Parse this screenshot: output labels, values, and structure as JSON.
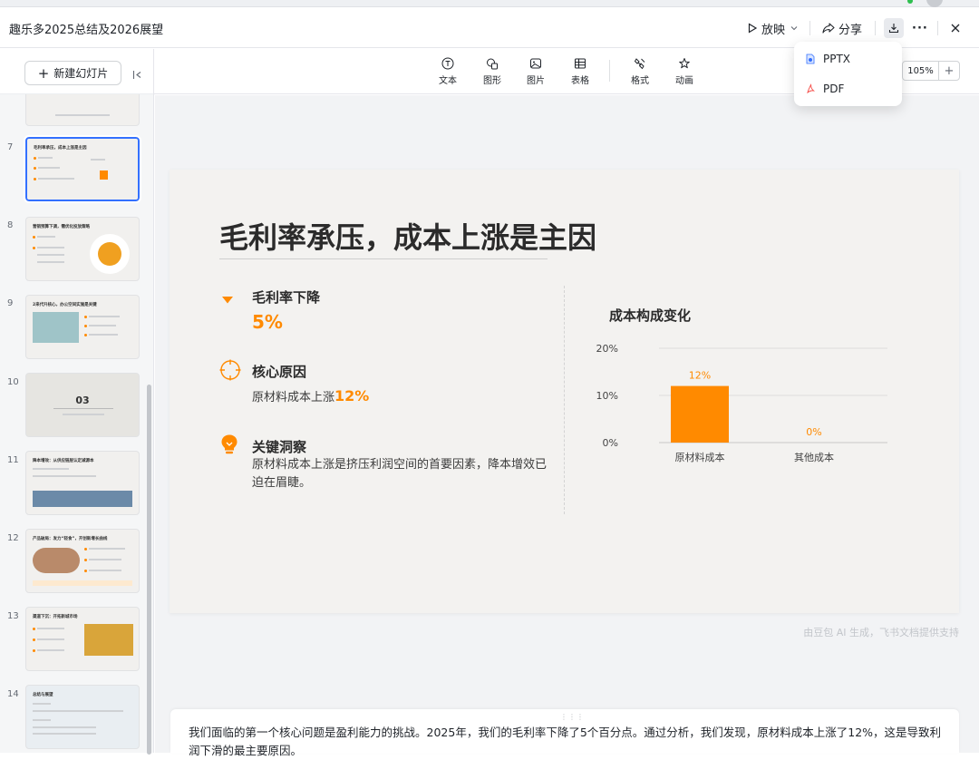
{
  "header": {
    "doc_title": "趣乐多2025总结及2026展望",
    "present_label": "放映",
    "share_label": "分享"
  },
  "download_menu": {
    "items": [
      {
        "label": "PPTX"
      },
      {
        "label": "PDF"
      }
    ]
  },
  "sidebar": {
    "new_slide_label": "新建幻灯片",
    "thumbnails": [
      {
        "num": "",
        "title": ""
      },
      {
        "num": "7",
        "title": "毛利率承压，成本上涨是主因",
        "selected": true
      },
      {
        "num": "8",
        "title": "营销预算下调，需优化投放策略"
      },
      {
        "num": "9",
        "title": "2来代升核心，办公空间实施是关键"
      },
      {
        "num": "10",
        "title": "03"
      },
      {
        "num": "11",
        "title": "降本增效：从供应链层认定减源本"
      },
      {
        "num": "12",
        "title": "产品破局：发力“轻食”，开创新增长曲线"
      },
      {
        "num": "13",
        "title": "渠道下沉：开拓新城市场"
      },
      {
        "num": "14",
        "title": "总结与展望"
      }
    ]
  },
  "toolbar": {
    "tools": [
      {
        "label": "文本",
        "icon": "text-icon"
      },
      {
        "label": "图形",
        "icon": "shape-icon"
      },
      {
        "label": "图片",
        "icon": "image-icon"
      },
      {
        "label": "表格",
        "icon": "table-icon"
      },
      {
        "label": "格式",
        "icon": "format-brush-icon"
      },
      {
        "label": "动画",
        "icon": "animation-icon"
      }
    ],
    "zoom": "105%"
  },
  "slide": {
    "title": "毛利率承压，成本上涨是主因",
    "point1": {
      "heading": "毛利率下降",
      "value": "5%"
    },
    "point2": {
      "heading": "核心原因",
      "text": "原材料成本上涨",
      "highlight": "12%"
    },
    "point3": {
      "heading": "关键洞察",
      "text": "原材料成本上涨是挤压利润空间的首要因素，降本增效已迫在眉睫。"
    },
    "chart_title": "成本构成变化"
  },
  "chart_data": {
    "type": "bar",
    "title": "成本构成变化",
    "categories": [
      "原材料成本",
      "其他成本"
    ],
    "values": [
      12,
      0
    ],
    "value_labels": [
      "12%",
      "0%"
    ],
    "y_ticks": [
      "0%",
      "10%",
      "20%"
    ],
    "ylim": [
      0,
      20
    ],
    "grid": true,
    "colors": {
      "bar": "#ff8a00",
      "label": "#ff8a00"
    }
  },
  "watermark": "由豆包 AI 生成，飞书文档提供支持",
  "notes": {
    "text": "我们面临的第一个核心问题是盈利能力的挑战。2025年，我们的毛利率下降了5个百分点。通过分析，我们发现，原材料成本上涨了12%，这是导致利润下滑的最主要原因。"
  },
  "colors": {
    "accent": "#ff8a00",
    "selection": "#3370ff"
  }
}
